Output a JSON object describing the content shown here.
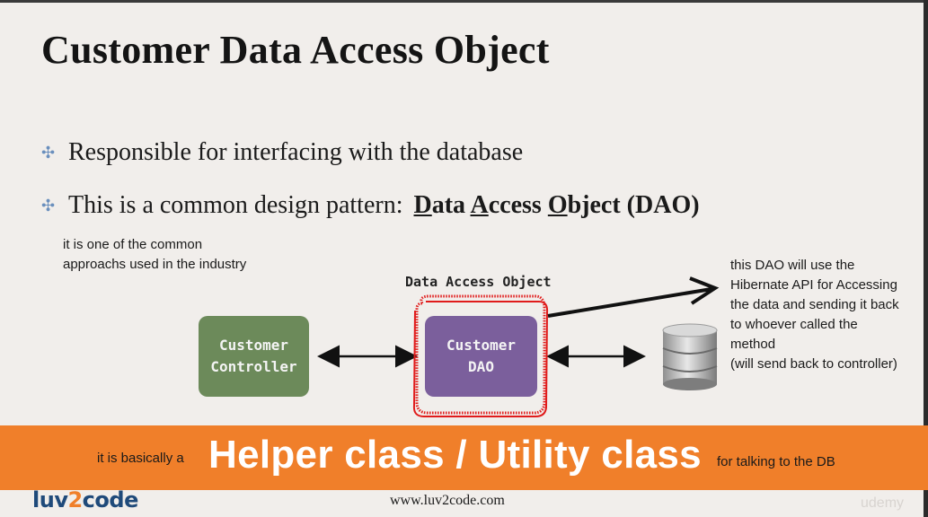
{
  "slide": {
    "title": "Customer Data Access Object",
    "bullets": [
      {
        "text": "Responsible for interfacing with the database"
      },
      {
        "prefix": "This is a common design pattern:",
        "dao_letters": [
          "D",
          "ata ",
          "A",
          "ccess ",
          "O",
          "bject (DAO)"
        ]
      }
    ]
  },
  "annotations": {
    "left_note_line1": "it is one of the common",
    "left_note_line2": "approachs used in the industry",
    "right_note": [
      "this DAO will use the",
      "Hibernate API for Accessing",
      "the data and sending it back",
      "to whoever called the",
      "method",
      "(will send back to controller)"
    ]
  },
  "diagram": {
    "dao_caption": "Data Access Object",
    "controller_box": {
      "line1": "Customer",
      "line2": "Controller"
    },
    "dao_box": {
      "line1": "Customer",
      "line2": "DAO"
    },
    "database_icon": "database-icon",
    "colors": {
      "controller": "#6c8a5a",
      "dao": "#7b5f9c",
      "highlight": "#e01b1b"
    }
  },
  "banner": {
    "left_text": "it is basically a",
    "big_text": "Helper class / Utility class",
    "right_text": "for talking to the DB",
    "color": "#f07f2a"
  },
  "footer": {
    "url": "www.luv2code.com",
    "logo_part1": "luv",
    "logo_part2": "2",
    "logo_part3": "code",
    "watermark": "udemy"
  }
}
